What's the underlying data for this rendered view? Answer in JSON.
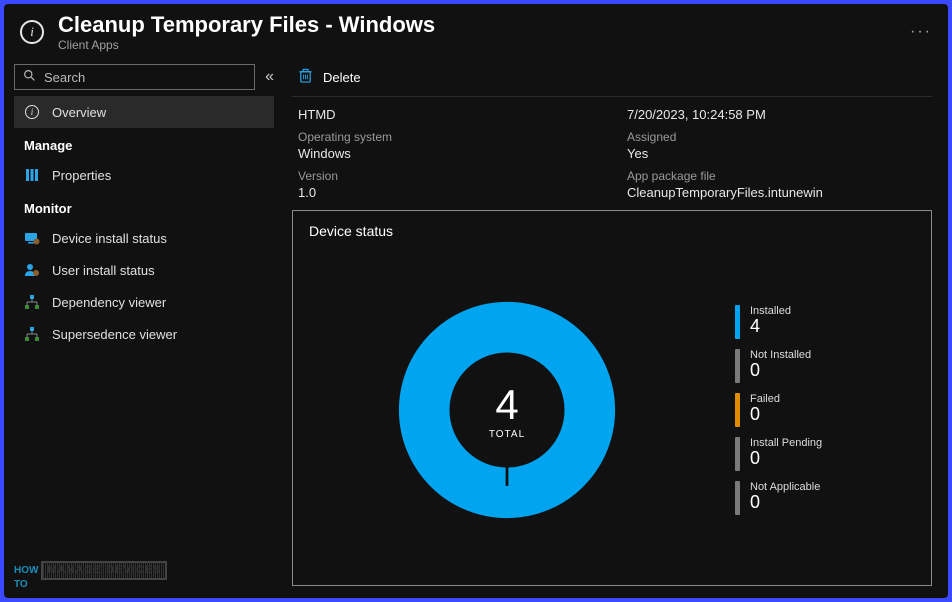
{
  "header": {
    "title": "Cleanup Temporary Files - Windows",
    "subtitle": "Client Apps",
    "more": "···"
  },
  "sidebar": {
    "search_placeholder": "Search",
    "items": {
      "overview": "Overview",
      "manage_label": "Manage",
      "properties": "Properties",
      "monitor_label": "Monitor",
      "device_install": "Device install status",
      "user_install": "User install status",
      "dependency": "Dependency viewer",
      "supersedence": "Supersedence viewer"
    }
  },
  "toolbar": {
    "delete_label": "Delete"
  },
  "props": {
    "htmd_value": "HTMD",
    "date_value": "7/20/2023, 10:24:58 PM",
    "os_label": "Operating system",
    "os_value": "Windows",
    "assigned_label": "Assigned",
    "assigned_value": "Yes",
    "version_label": "Version",
    "version_value": "1.0",
    "package_label": "App package file",
    "package_value": "CleanupTemporaryFiles.intunewin"
  },
  "panel": {
    "title": "Device status",
    "total_label": "TOTAL"
  },
  "chart_data": {
    "type": "pie",
    "title": "Device status",
    "total": 4,
    "series": [
      {
        "name": "Installed",
        "value": 4,
        "color": "#00a4ef"
      },
      {
        "name": "Not Installed",
        "value": 0,
        "color": "#7a7a7a"
      },
      {
        "name": "Failed",
        "value": 0,
        "color": "#e08e00"
      },
      {
        "name": "Install Pending",
        "value": 0,
        "color": "#7a7a7a"
      },
      {
        "name": "Not Applicable",
        "value": 0,
        "color": "#7a7a7a"
      }
    ]
  },
  "logo": {
    "l1": "HOW",
    "l2": "TO",
    "box": "MANAGE DEVICES"
  }
}
